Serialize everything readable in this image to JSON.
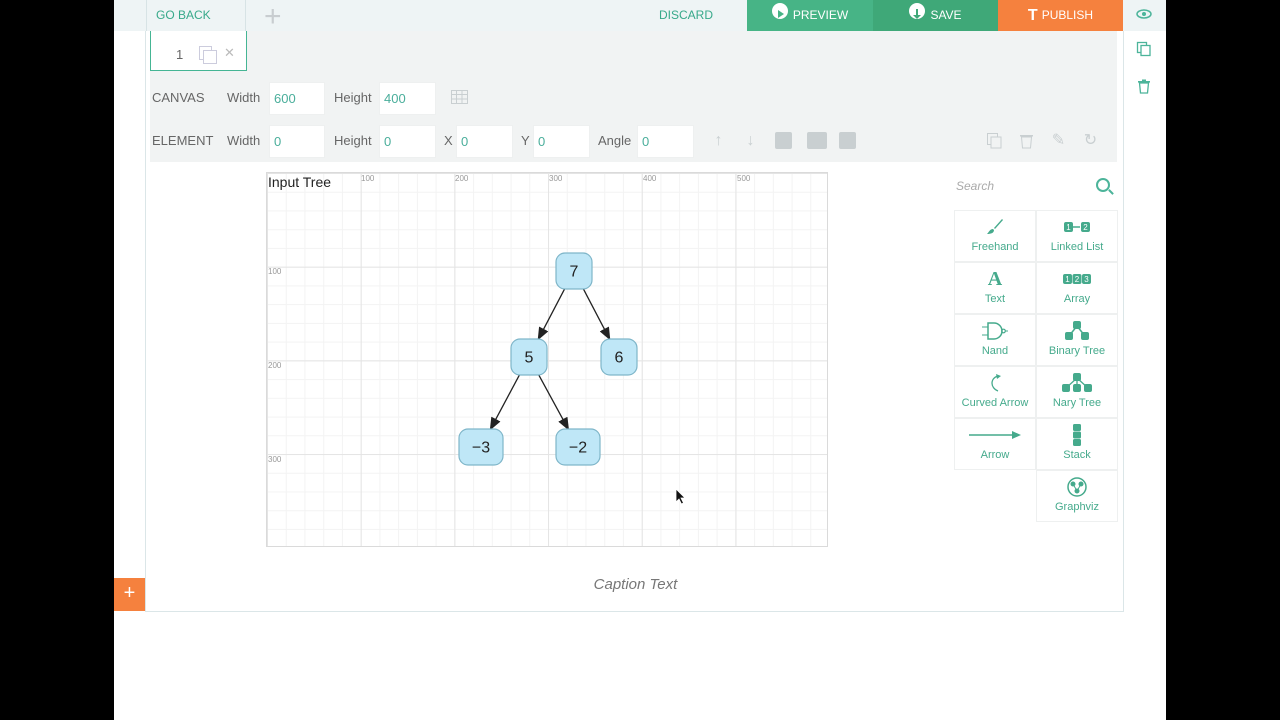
{
  "topbar": {
    "go_back": "GO BACK",
    "discard": "DISCARD",
    "preview": "PREVIEW",
    "save": "SAVE",
    "publish": "PUBLISH"
  },
  "page_tabs": [
    {
      "label": "1"
    }
  ],
  "canvas_props": {
    "label": "CANVAS",
    "width_label": "Width",
    "width_value": "600",
    "height_label": "Height",
    "height_value": "400"
  },
  "element_props": {
    "label": "ELEMENT",
    "width_label": "Width",
    "width_value": "0",
    "height_label": "Height",
    "height_value": "0",
    "x_label": "X",
    "x_value": "0",
    "y_label": "Y",
    "y_value": "0",
    "angle_label": "Angle",
    "angle_value": "0"
  },
  "canvas": {
    "title": "Input Tree",
    "x_ticks": [
      "100",
      "200",
      "300",
      "400",
      "500"
    ],
    "y_ticks": [
      "100",
      "200",
      "300"
    ],
    "tree": {
      "nodes": [
        {
          "id": "n7",
          "label": "7"
        },
        {
          "id": "n5",
          "label": "5"
        },
        {
          "id": "n6",
          "label": "6"
        },
        {
          "id": "nm3",
          "label": "−3"
        },
        {
          "id": "nm2",
          "label": "−2"
        }
      ],
      "edges": [
        [
          "n7",
          "n5"
        ],
        [
          "n7",
          "n6"
        ],
        [
          "n5",
          "nm3"
        ],
        [
          "n5",
          "nm2"
        ]
      ],
      "node_fill": "#bfe7f7",
      "node_stroke": "#7fb6c9"
    }
  },
  "caption": "Caption Text",
  "search": {
    "placeholder": "Search"
  },
  "palette": [
    {
      "label": "Freehand",
      "icon": "brush-icon"
    },
    {
      "label": "Linked List",
      "icon": "linked-list-icon"
    },
    {
      "label": "Text",
      "icon": "text-icon"
    },
    {
      "label": "Array",
      "icon": "array-icon"
    },
    {
      "label": "Nand",
      "icon": "nand-gate-icon"
    },
    {
      "label": "Binary Tree",
      "icon": "binary-tree-icon"
    },
    {
      "label": "Curved Arrow",
      "icon": "curved-arrow-icon"
    },
    {
      "label": "Nary Tree",
      "icon": "nary-tree-icon"
    },
    {
      "label": "Arrow",
      "icon": "arrow-icon"
    },
    {
      "label": "Stack",
      "icon": "stack-icon"
    },
    {
      "label": "Graphviz",
      "icon": "graphviz-icon"
    }
  ],
  "colors": {
    "accent": "#45aa8c",
    "preview": "#47b486",
    "save": "#3fa878",
    "publish": "#f5813e"
  }
}
